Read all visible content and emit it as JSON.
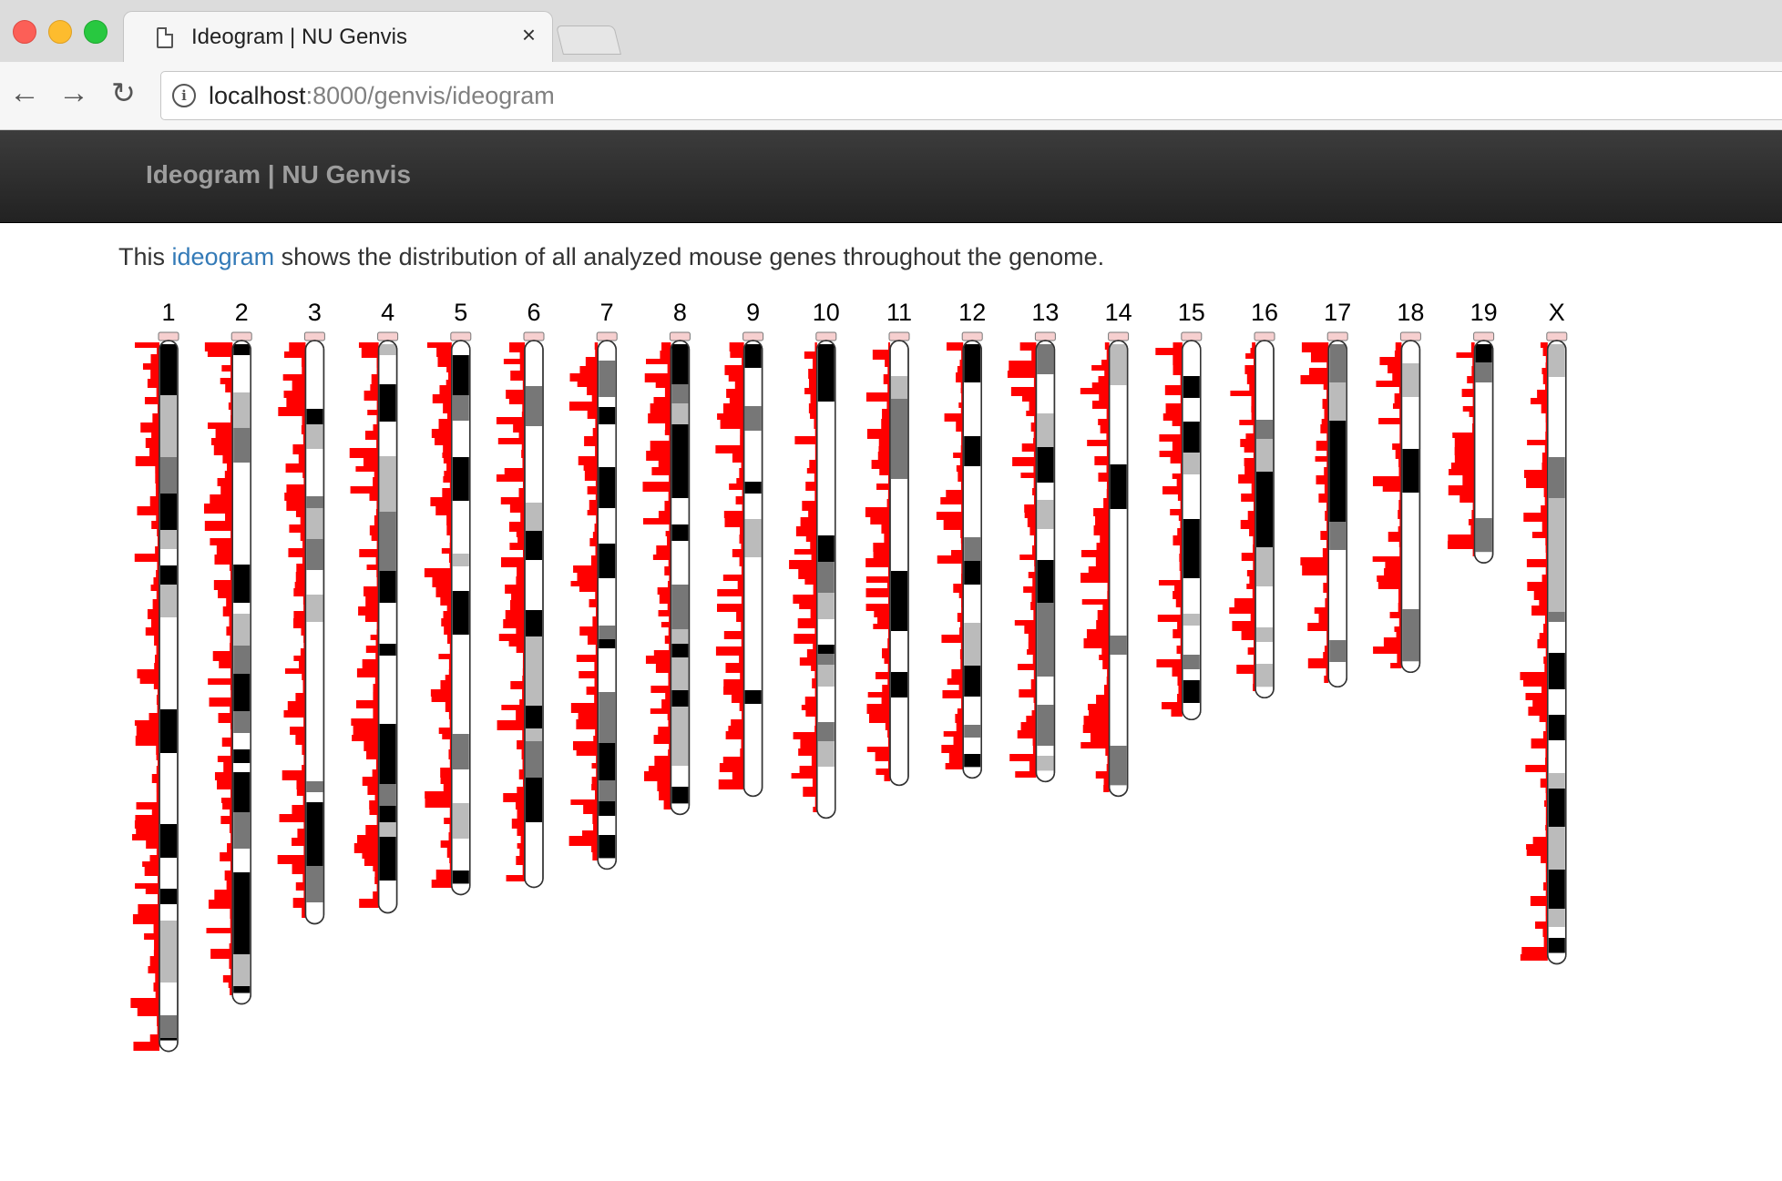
{
  "browser": {
    "tab_title": "Ideogram | NU Genvis",
    "tab_close": "×",
    "url_host": "localhost",
    "url_path": ":8000/genvis/ideogram",
    "nav": {
      "back": "←",
      "forward": "→",
      "reload": "↻"
    }
  },
  "navbar": {
    "brand": "Ideogram | NU Genvis"
  },
  "intro": {
    "prefix": "This ",
    "link": "ideogram",
    "suffix": " shows the distribution of all analyzed mouse genes throughout the genome."
  },
  "colors": {
    "histogram": "#ff0000",
    "band_dark": "#000000",
    "band_mid": "#777777",
    "band_light": "#bbbbbb",
    "link": "#337ab7"
  },
  "ideogram": {
    "organism": "mouse",
    "chromosomes": [
      {
        "name": "1",
        "length": 195
      },
      {
        "name": "2",
        "length": 182
      },
      {
        "name": "3",
        "length": 160
      },
      {
        "name": "4",
        "length": 157
      },
      {
        "name": "5",
        "length": 152
      },
      {
        "name": "6",
        "length": 150
      },
      {
        "name": "7",
        "length": 145
      },
      {
        "name": "8",
        "length": 130
      },
      {
        "name": "9",
        "length": 125
      },
      {
        "name": "10",
        "length": 131
      },
      {
        "name": "11",
        "length": 122
      },
      {
        "name": "12",
        "length": 120
      },
      {
        "name": "13",
        "length": 121
      },
      {
        "name": "14",
        "length": 125
      },
      {
        "name": "15",
        "length": 104
      },
      {
        "name": "16",
        "length": 98
      },
      {
        "name": "17",
        "length": 95
      },
      {
        "name": "18",
        "length": 91
      },
      {
        "name": "19",
        "length": 61
      },
      {
        "name": "X",
        "length": 171
      }
    ]
  }
}
